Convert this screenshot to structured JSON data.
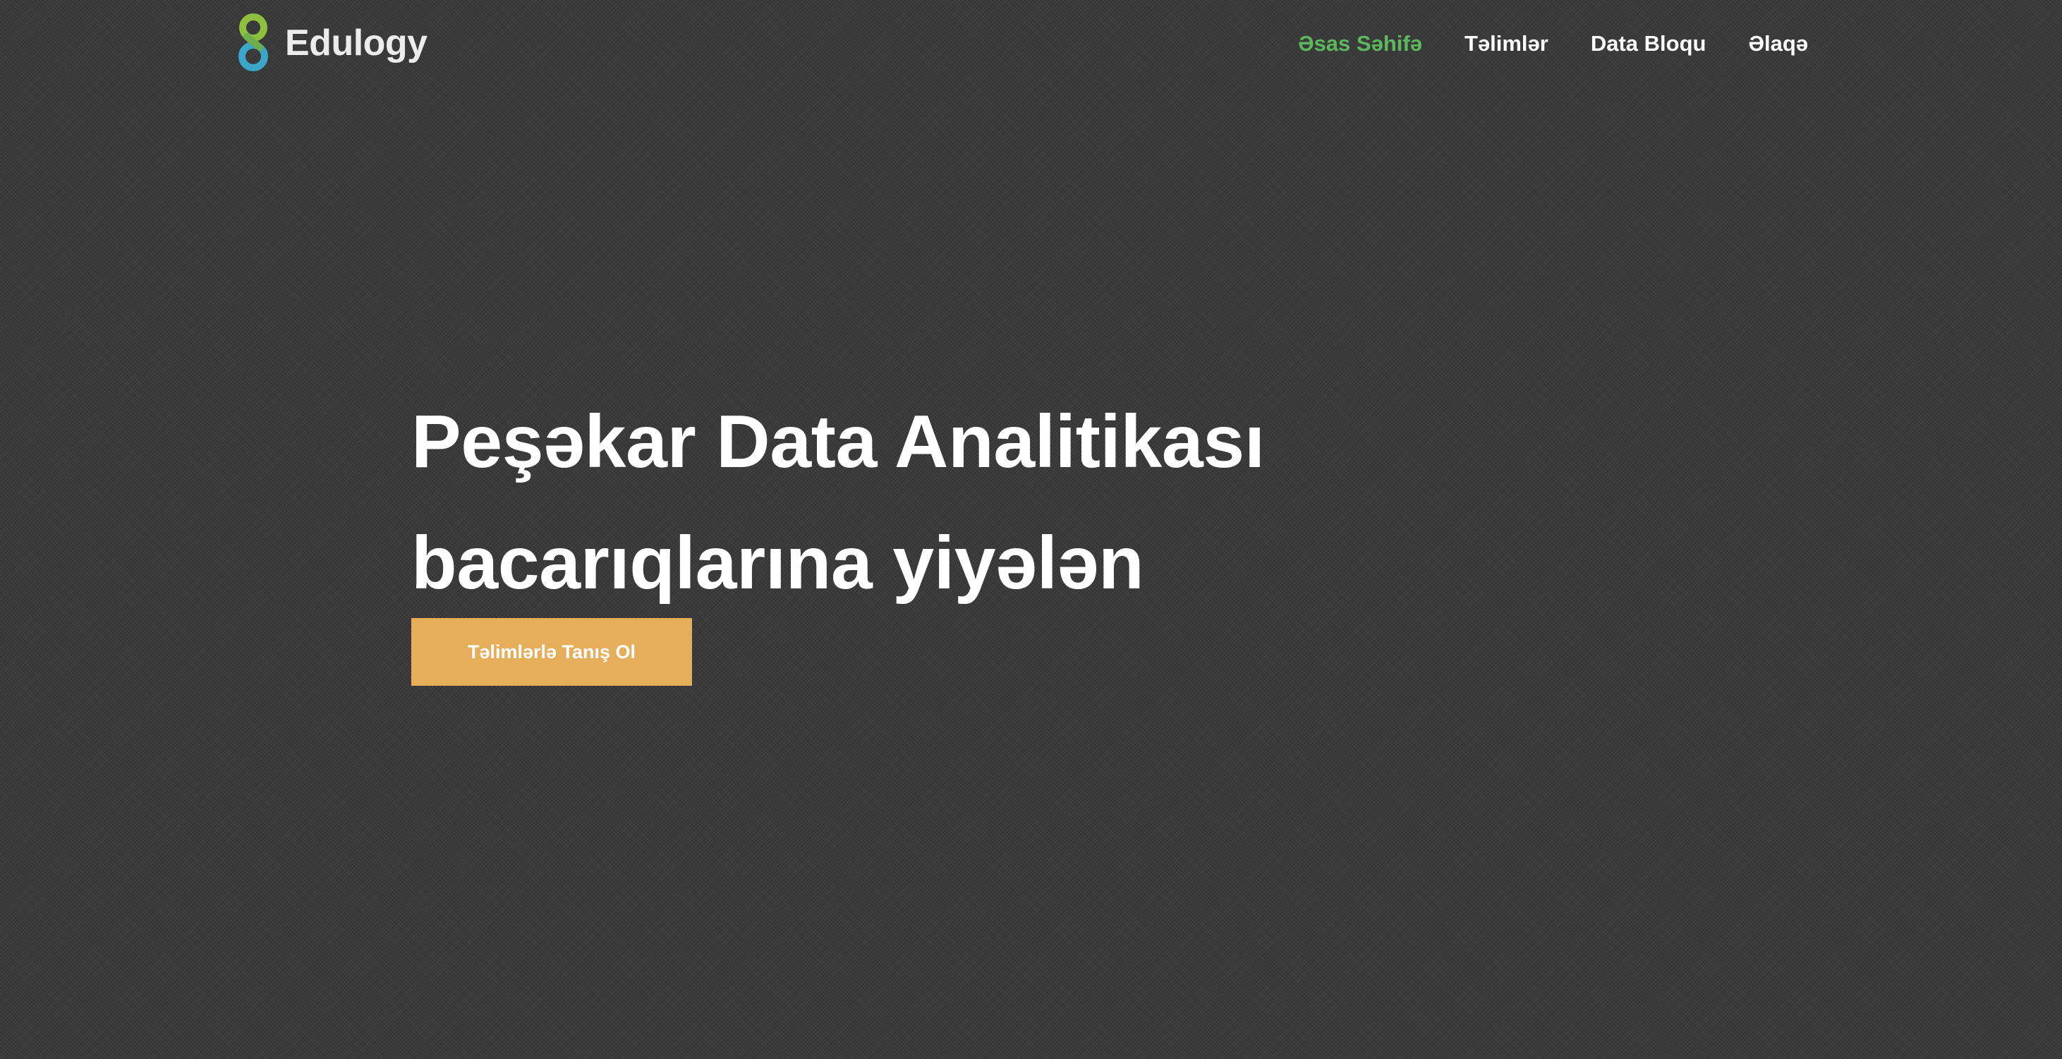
{
  "brand": {
    "name": "Edulogy",
    "logo_icon": "edulogy-figure-eight-icon",
    "colors": {
      "logo_green": "#8fbf3f",
      "logo_blue": "#3aa7c9"
    }
  },
  "nav": {
    "items": [
      {
        "label": "Əsas Səhifə",
        "active": true
      },
      {
        "label": "Təlimlər",
        "active": false
      },
      {
        "label": "Data Bloqu",
        "active": false
      },
      {
        "label": "Əlaqə",
        "active": false
      }
    ],
    "active_color": "#5cb85c"
  },
  "hero": {
    "title_line1": "Peşəkar Data Analitikası",
    "title_line2": "bacarıqlarına yiyələn",
    "cta_label": "Təlimlərlə Tanış Ol",
    "cta_color": "#e6ae5b"
  }
}
